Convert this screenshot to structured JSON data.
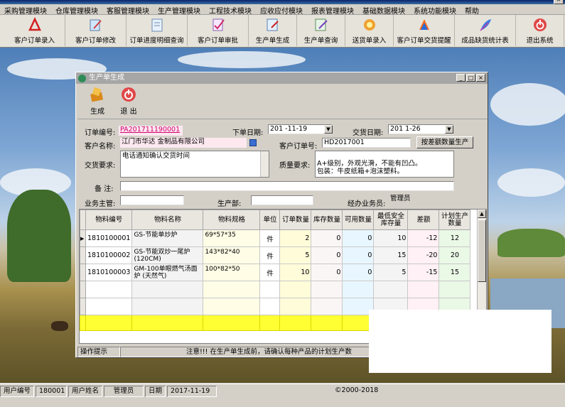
{
  "menu": [
    "采购管理模块",
    "仓库管理模块",
    "客服管理模块",
    "生产管理模块",
    "工程技术模块",
    "应收应付模块",
    "报表管理模块",
    "基础数据模块",
    "系统功能模块",
    "帮助"
  ],
  "toolbar": [
    {
      "label": "客户订单录入",
      "icon": "pdf-icon"
    },
    {
      "label": "客户订单修改",
      "icon": "edit-doc-icon"
    },
    {
      "label": "订单进度明细查询",
      "icon": "document-icon"
    },
    {
      "label": "客户订单审批",
      "icon": "approve-icon"
    },
    {
      "label": "生产单生成",
      "icon": "generate-icon"
    },
    {
      "label": "生产单查询",
      "icon": "query-icon"
    },
    {
      "label": "送货单录入",
      "icon": "flower-icon"
    },
    {
      "label": "客户订单交货提醒",
      "icon": "reminder-icon"
    },
    {
      "label": "成品缺货统计表",
      "icon": "feather-icon"
    },
    {
      "label": "退出系统",
      "icon": "exit-icon"
    }
  ],
  "dialog": {
    "title": "生产单生成",
    "toolbar": {
      "generate_label": "生成",
      "exit_label": "退 出"
    },
    "form": {
      "order_no_label": "订单编号:",
      "order_no": "PA20171119​0001",
      "order_date_label": "下单日期:",
      "order_date": "201  -11-19",
      "delivery_date_label": "交货日期:",
      "delivery_date": "201   1-26",
      "customer_label": "客户名称:",
      "customer": "江门市华达  金制品有限公司",
      "cust_order_label": "客户订单号:",
      "cust_order": "HD2017001",
      "diff_button": "按差额数量生产",
      "delivery_req_label": "交货要求:",
      "delivery_req": "电话通知确认交货时间",
      "quality_req_label": "质量要求:",
      "quality_req": "A+级别，外观光滑，不能有凹凸。\n包装：牛皮纸箱+泡沫塑料。",
      "remark_label": "备  注:",
      "remark": "",
      "supervisor_label": "业务主管:",
      "supervisor": "",
      "dept_label": "生产部:",
      "dept": "",
      "handler_label": "经办业务员:",
      "handler": "管理员"
    },
    "grid": {
      "columns": [
        "物料编号",
        "物料名称",
        "物料规格",
        "单位",
        "订单数量",
        "库存数量",
        "可用数量",
        "最低安全库存量",
        "差额",
        "计划生产数量"
      ],
      "rows": [
        {
          "code": "1810100001",
          "name": "GS-节能单炒炉",
          "spec": "69*57*35",
          "unit": "件",
          "order": "2",
          "stock": "0",
          "avail": "0",
          "safe": "10",
          "diff": "-12",
          "plan": "12"
        },
        {
          "code": "1810100002",
          "name": "GS-节能双炒一尾炉 (120CM)",
          "spec": "143*82*40",
          "unit": "件",
          "order": "5",
          "stock": "0",
          "avail": "0",
          "safe": "15",
          "diff": "-20",
          "plan": "20"
        },
        {
          "code": "1810100003",
          "name": "GM-100单眼燃气汤面炉 (天然气)",
          "spec": "100*82*50",
          "unit": "件",
          "order": "10",
          "stock": "0",
          "avail": "0",
          "safe": "5",
          "diff": "-15",
          "plan": "15"
        }
      ]
    },
    "status": {
      "label": "操作提示",
      "message": "注意!!!   在生产单生成前，请确认每种产品的计划生产数"
    }
  },
  "statusbar": {
    "user_no_label": "用户编号",
    "user_no": "180001",
    "user_name_label": "用户姓名",
    "user_name": "管理员",
    "date_label": "日期",
    "date": "2017-11-19",
    "copyright": "©2000-2018"
  }
}
